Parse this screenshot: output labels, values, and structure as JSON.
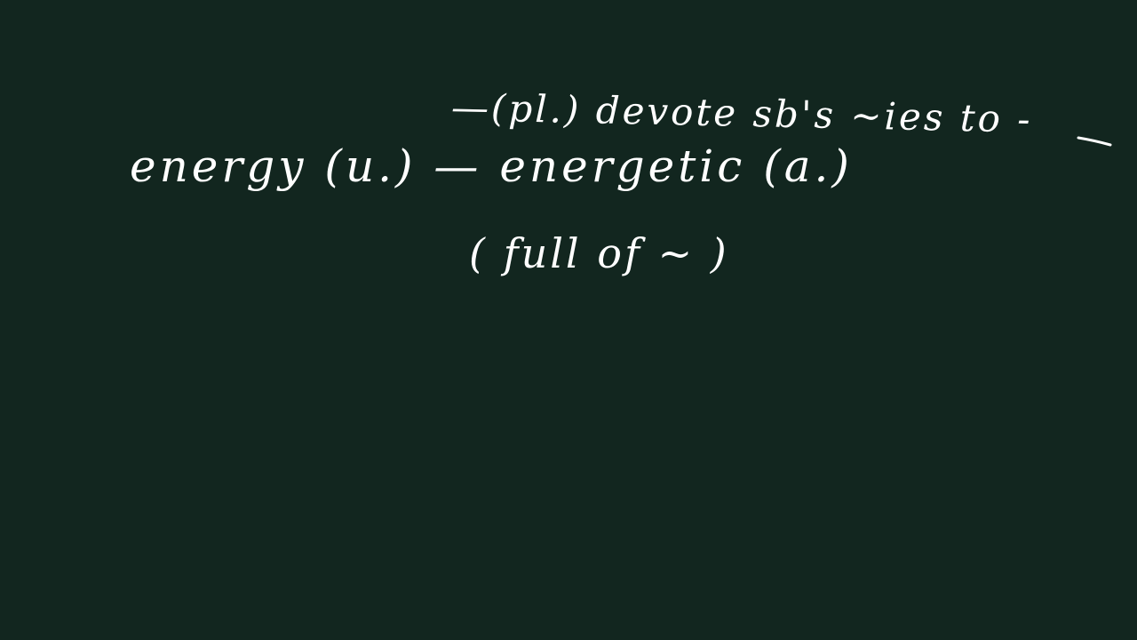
{
  "board": {
    "background_color": "#12261f",
    "ink_color": "#ffffff",
    "lines": {
      "top": "—(pl.) devote sb's ~ies to - ",
      "main": "energy (u.) — energetic (a.)",
      "paren": "( full of ~ )"
    }
  }
}
